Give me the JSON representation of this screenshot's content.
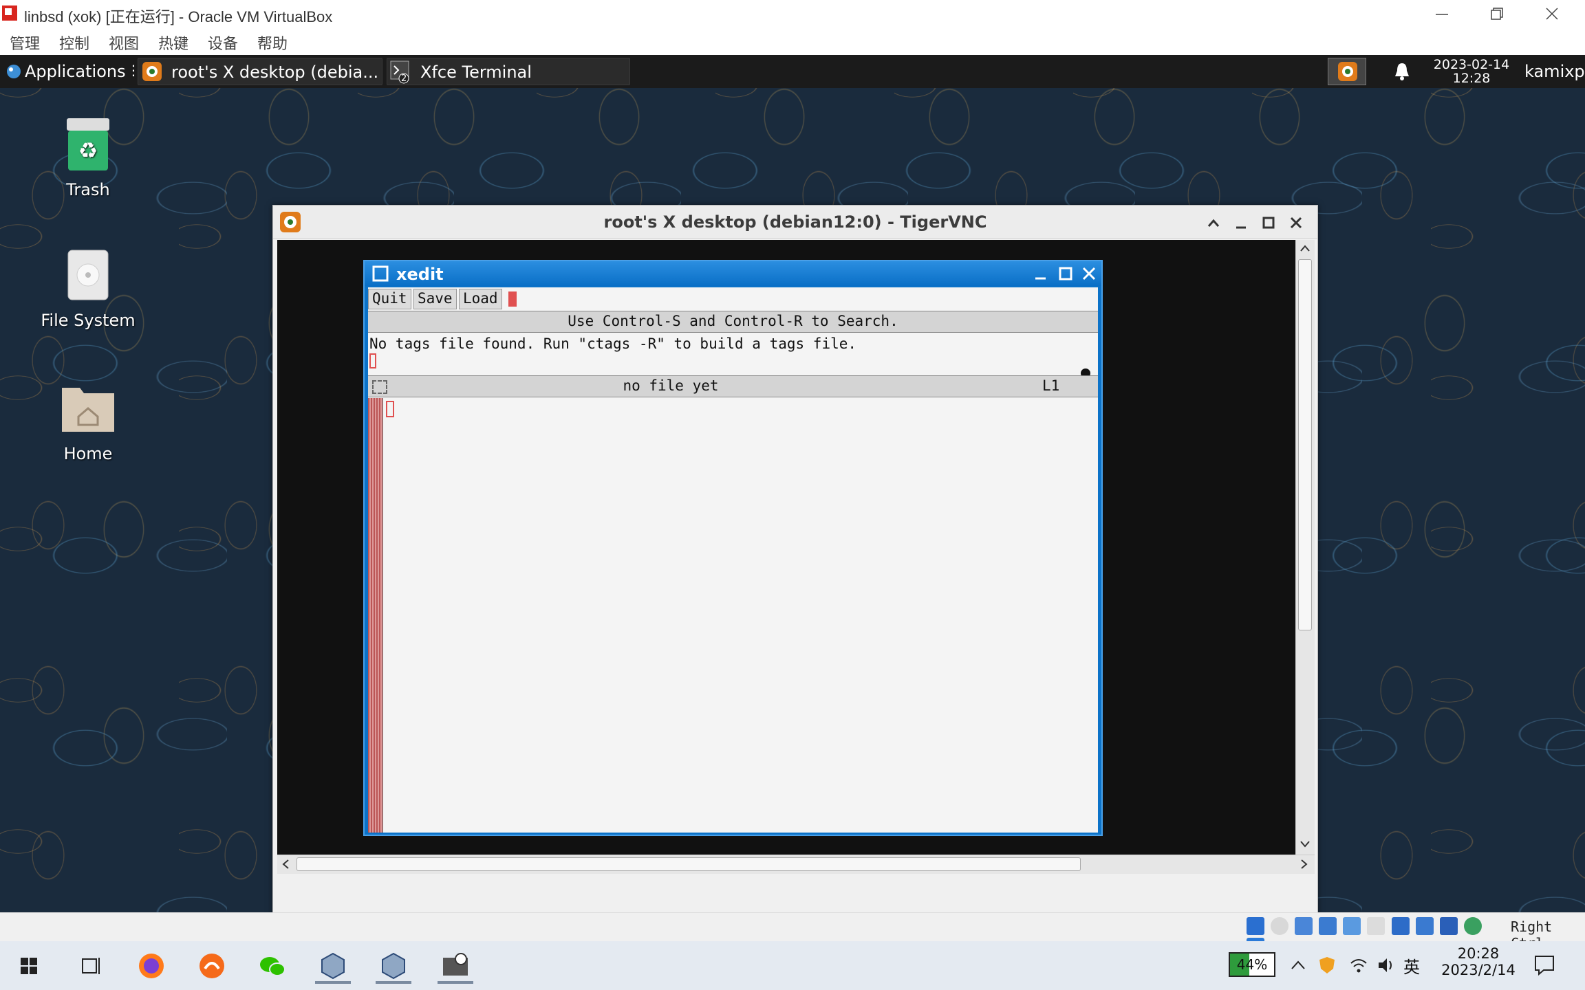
{
  "host_window": {
    "title": "linbsd (xok) [正在运行] - Oracle VM VirtualBox",
    "menu": [
      "管理",
      "控制",
      "视图",
      "热键",
      "设备",
      "帮助"
    ]
  },
  "xfce_panel": {
    "applications_label": "Applications",
    "tasks": [
      {
        "label": "root's X desktop (debia...",
        "icon": "tigervnc-icon"
      },
      {
        "label": "Xfce Terminal",
        "icon": "terminal-icon",
        "badge": "2"
      }
    ],
    "clock_date": "2023-02-14",
    "clock_time": "12:28",
    "user": "kamixp"
  },
  "desktop_icons": [
    {
      "label": "Trash",
      "icon": "trash-icon"
    },
    {
      "label": "File System",
      "icon": "drive-icon"
    },
    {
      "label": "Home",
      "icon": "home-folder-icon"
    }
  ],
  "vnc_window": {
    "title": "root's X desktop (debian12:0) - TigerVNC"
  },
  "xedit": {
    "title": "xedit",
    "buttons": {
      "quit": "Quit",
      "save": "Save",
      "load": "Load"
    },
    "search_hint": "Use Control-S and Control-R to Search.",
    "message": "No tags file found. Run \"ctags -R\" to build a tags file.",
    "filename": "no file yet",
    "line_indicator": "L1"
  },
  "vb_statusbar": {
    "host_key": "Right Ctrl"
  },
  "win_taskbar": {
    "battery": "44%",
    "ime": "英",
    "time": "20:28",
    "date": "2023/2/14",
    "colors": {
      "accent": "#0a6fc6",
      "battery": "#2e9b3c"
    }
  }
}
